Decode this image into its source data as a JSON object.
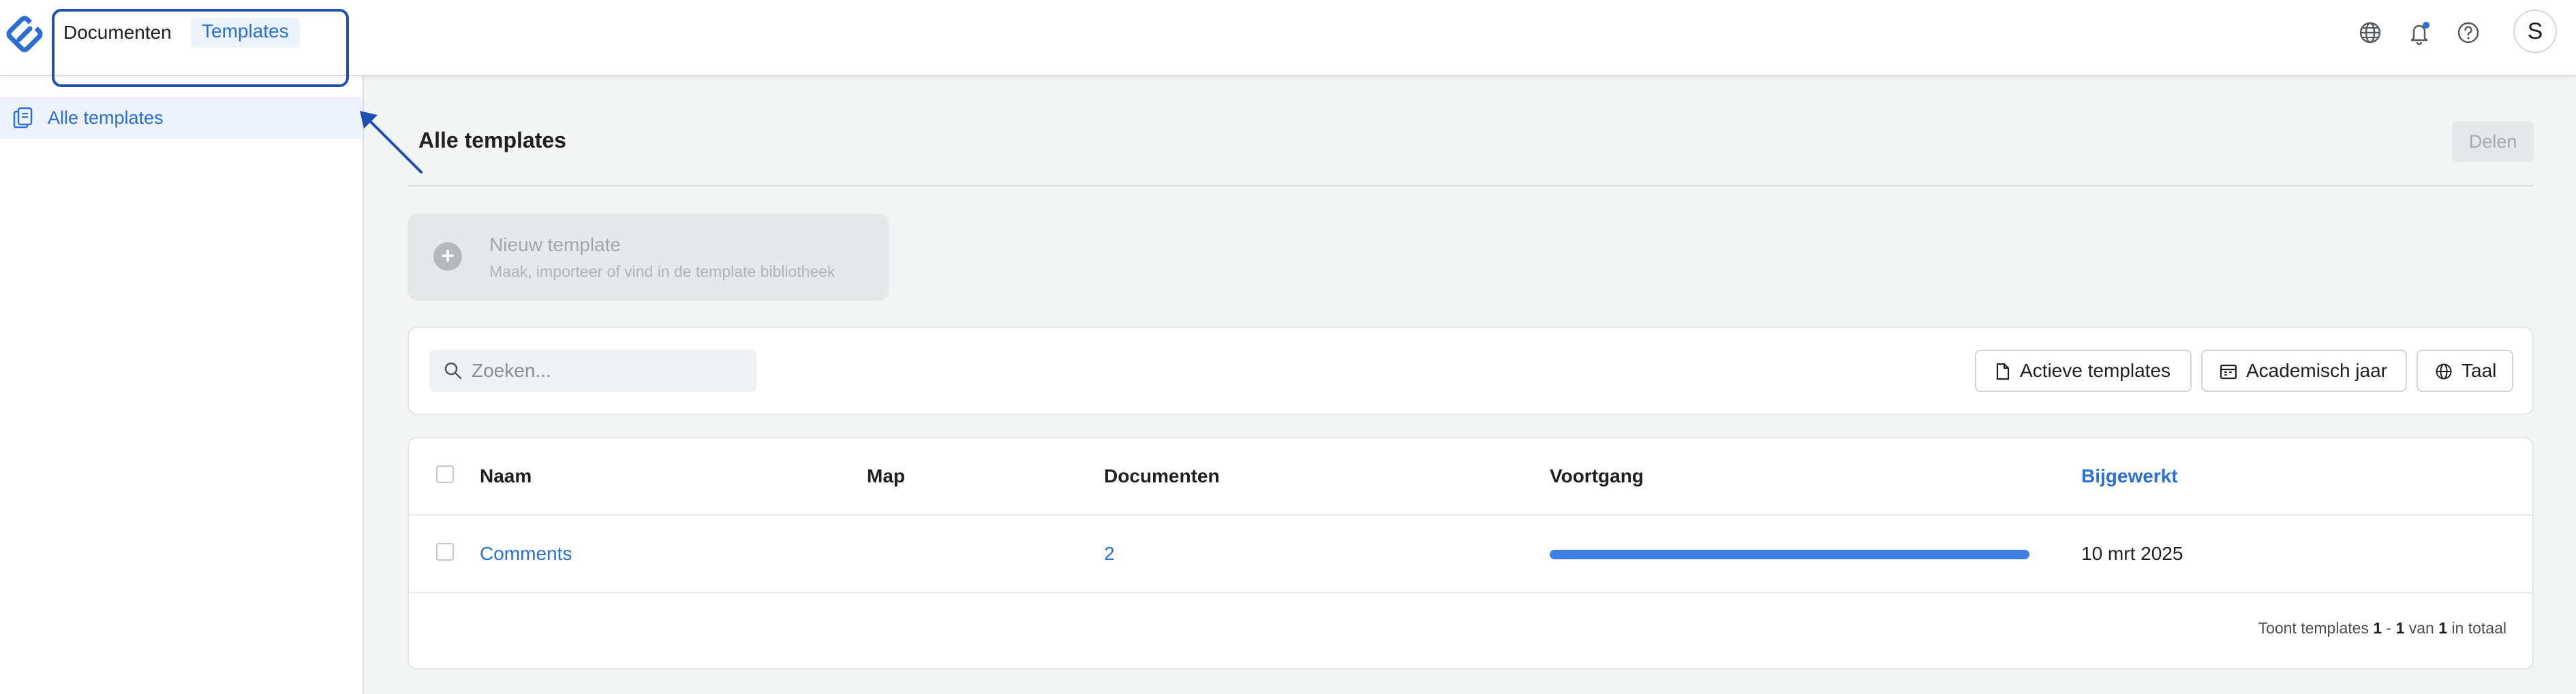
{
  "topbar": {
    "nav": {
      "documenten": "Documenten",
      "templates": "Templates"
    },
    "icons": [
      "globe-icon",
      "bell-icon",
      "help-icon"
    ],
    "avatar_initial": "S"
  },
  "sidebar": {
    "items": [
      {
        "label": "Alle templates",
        "icon": "templates-icon",
        "active": true
      }
    ]
  },
  "main": {
    "title": "Alle templates",
    "share_label": "Delen",
    "new_template": {
      "title": "Nieuw template",
      "subtitle": "Maak, importeer of vind in de template bibliotheek"
    },
    "search": {
      "placeholder": "Zoeken...",
      "value": ""
    },
    "filters": {
      "actieve": "Actieve templates",
      "academisch": "Academisch jaar",
      "taal": "Taal"
    },
    "table": {
      "columns": [
        "Naam",
        "Map",
        "Documenten",
        "Voortgang",
        "Bijgewerkt"
      ],
      "rows": [
        {
          "naam": "Comments",
          "map": "",
          "documenten": "2",
          "voortgang": 1.0,
          "bijgewerkt": "10 mrt 2025"
        }
      ],
      "footer": {
        "prefix": "Toont templates",
        "from": "1",
        "to": "1",
        "of_word": "van",
        "total": "1",
        "suffix": "in totaal"
      }
    }
  },
  "colors": {
    "accent": "#2a6fd3",
    "progress": "#3f7ee4",
    "annotation": "#1d4fb3"
  }
}
